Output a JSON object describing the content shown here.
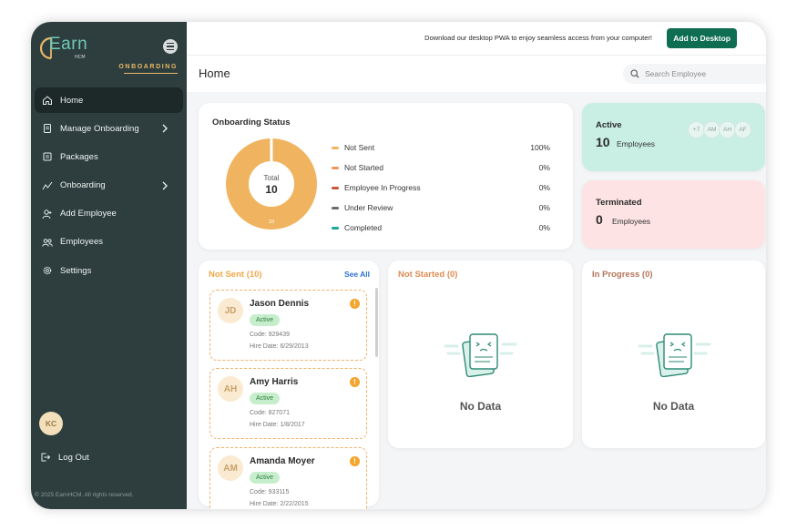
{
  "app": {
    "logo_text": "Earn",
    "logo_sub": "HCM",
    "module": "ONBOARDING",
    "copyright": "© 2025 EarnHCM. All rights reserved."
  },
  "sidebar": {
    "items": [
      {
        "label": "Home",
        "icon": "home-icon"
      },
      {
        "label": "Manage Onboarding",
        "icon": "document-icon"
      },
      {
        "label": "Packages",
        "icon": "package-icon"
      },
      {
        "label": "Onboarding",
        "icon": "onboarding-icon"
      },
      {
        "label": "Add Employee",
        "icon": "add-user-icon"
      },
      {
        "label": "Employees",
        "icon": "users-icon"
      },
      {
        "label": "Settings",
        "icon": "gear-icon"
      }
    ],
    "user_initials": "KC",
    "logout_label": "Log Out"
  },
  "topbar": {
    "pwa_message": "Download our desktop PWA to enjoy seamless access from your computer!",
    "add_desktop_label": "Add to Desktop"
  },
  "header": {
    "title": "Home",
    "search_placeholder": "Search Employee"
  },
  "status": {
    "title": "Onboarding Status",
    "total_label": "Total",
    "total_value": "10",
    "segment_label": "10",
    "legend": [
      {
        "label": "Not Sent",
        "pct": "100%",
        "color": "#f0b460"
      },
      {
        "label": "Not Started",
        "pct": "0%",
        "color": "#f0955a"
      },
      {
        "label": "Employee In Progress",
        "pct": "0%",
        "color": "#c8563a"
      },
      {
        "label": "Under Review",
        "pct": "0%",
        "color": "#6b6b6b"
      },
      {
        "label": "Completed",
        "pct": "0%",
        "color": "#1aa89a"
      }
    ]
  },
  "active": {
    "label": "Active",
    "count": "10",
    "unit": "Employees",
    "avatars": [
      "+7",
      "AM",
      "AH",
      "AF"
    ]
  },
  "terminated": {
    "label": "Terminated",
    "count": "0",
    "unit": "Employees"
  },
  "not_sent": {
    "title": "Not Sent (10)",
    "see_all": "See All",
    "employees": [
      {
        "initials": "JD",
        "name": "Jason Dennis",
        "status": "Active",
        "code": "Code: 929439",
        "hire": "Hire Date: 6/29/2013"
      },
      {
        "initials": "AH",
        "name": "Amy Harris",
        "status": "Active",
        "code": "Code: 827071",
        "hire": "Hire Date: 1/8/2017"
      },
      {
        "initials": "AM",
        "name": "Amanda Moyer",
        "status": "Active",
        "code": "Code: 933115",
        "hire": "Hire Date: 2/22/2015"
      }
    ]
  },
  "not_started": {
    "title": "Not Started (0)",
    "empty": "No Data"
  },
  "in_progress": {
    "title": "In Progress (0)",
    "empty": "No Data"
  }
}
